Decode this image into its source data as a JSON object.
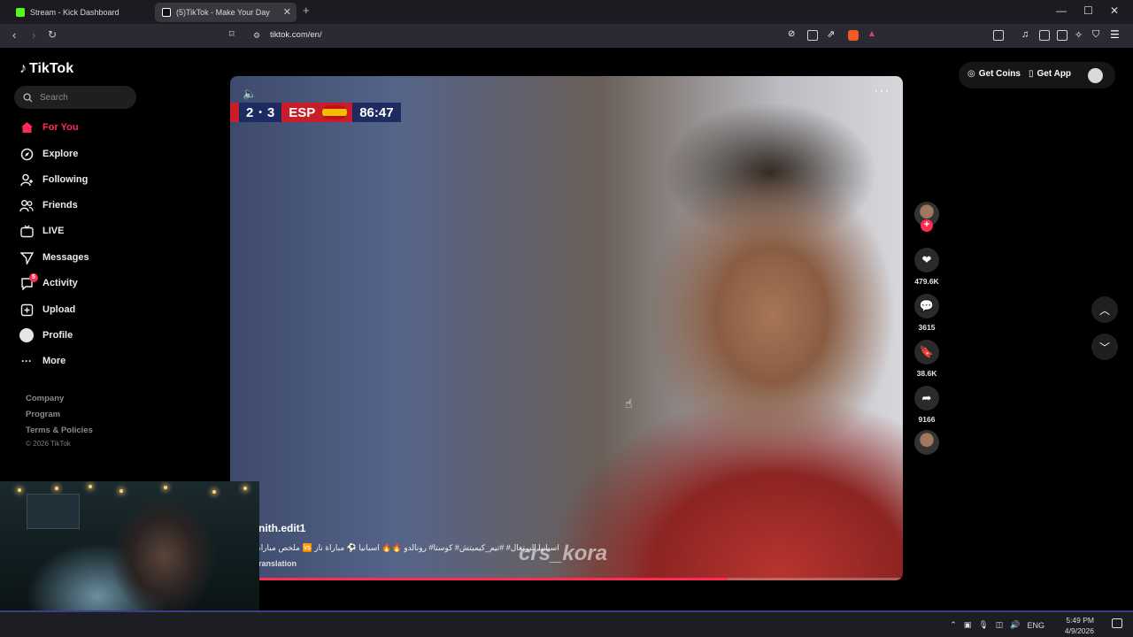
{
  "browser": {
    "tabs": [
      {
        "title": "Stream - Kick Dashboard",
        "favicon_color": "#53fc18"
      },
      {
        "title": "(5)TikTok - Make Your Day",
        "favicon_color": "#ffffff"
      }
    ],
    "url": "tiktok.com/en/"
  },
  "sidebar": {
    "logo": "TikTok",
    "search_placeholder": "Search",
    "items": [
      {
        "label": "For You",
        "icon": "home-icon"
      },
      {
        "label": "Explore",
        "icon": "compass-icon"
      },
      {
        "label": "Following",
        "icon": "person-plus-icon"
      },
      {
        "label": "Friends",
        "icon": "people-icon"
      },
      {
        "label": "LIVE",
        "icon": "tv-icon"
      },
      {
        "label": "Messages",
        "icon": "send-icon"
      },
      {
        "label": "Activity",
        "icon": "bell-chat-icon",
        "badge": "5"
      },
      {
        "label": "Upload",
        "icon": "plus-square-icon"
      },
      {
        "label": "Profile",
        "icon": "avatar-icon"
      },
      {
        "label": "More",
        "icon": "ellipsis-icon"
      }
    ],
    "footer_links": [
      "Company",
      "Program",
      "Terms & Policies"
    ],
    "copyright": "© 2026 TikTok"
  },
  "header": {
    "get_coins": "Get Coins",
    "get_app": "Get App"
  },
  "video": {
    "scoreboard": {
      "score_left": "2",
      "score_right": "3",
      "team": "ESP",
      "clock": "86:47"
    },
    "author": "nith.edit1",
    "caption": "اسبانيا البرتغال# ‎#تيم_كيميتش# كوستا# رونالدو 🔥🔥 اسبانيا ⚽ مباراة نار 🆚 ملخص مباراة",
    "translation_link": "ranslation",
    "watermark": "crs_kora",
    "progress": 0.74
  },
  "actions": {
    "likes": "479.6K",
    "comments": "3615",
    "saves": "38.6K",
    "shares": "9166"
  },
  "taskbar": {
    "language": "ENG",
    "time": "5:49 PM",
    "date": "4/9/2026"
  },
  "colors": {
    "accent": "#fe2c55",
    "background": "#000000"
  }
}
